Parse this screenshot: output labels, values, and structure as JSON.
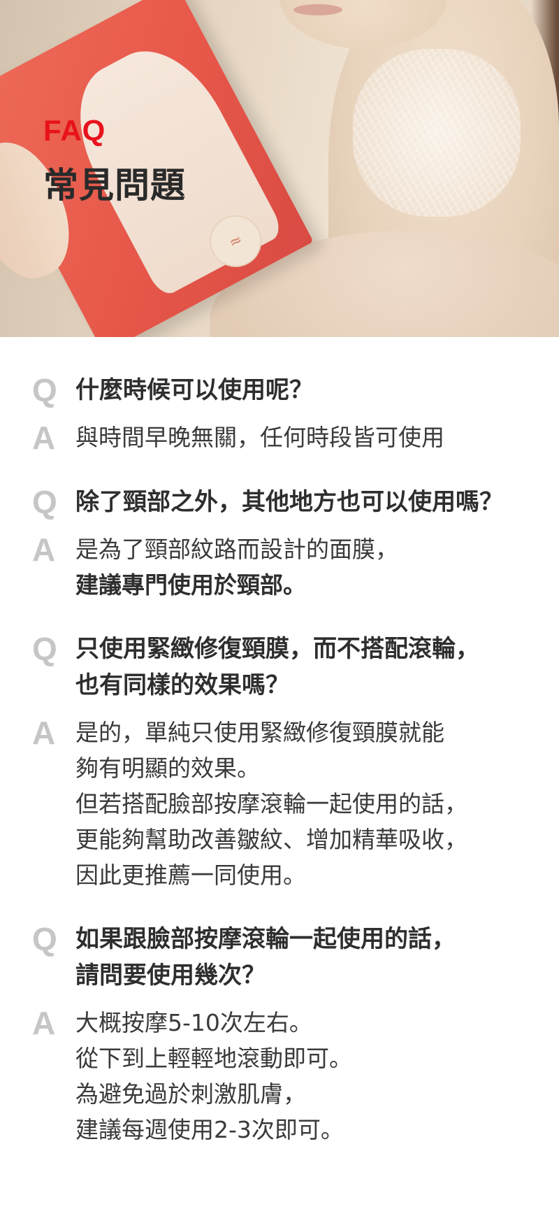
{
  "header": {
    "faq_label": "FAQ",
    "title": "常見問題"
  },
  "faq": [
    {
      "q_mark": "Q",
      "question_lines": [
        "什麼時候可以使用呢？"
      ],
      "a_mark": "A",
      "answer_lines": [
        {
          "text": "與時間早晚無關，任何時段皆可使用",
          "bold": false
        }
      ]
    },
    {
      "q_mark": "Q",
      "question_lines": [
        "除了頸部之外，其他地方也可以使用嗎？"
      ],
      "a_mark": "A",
      "answer_lines": [
        {
          "text": "是為了頸部紋路而設計的面膜，",
          "bold": false
        },
        {
          "text": "建議專門使用於頸部。",
          "bold": true
        }
      ]
    },
    {
      "q_mark": "Q",
      "question_lines": [
        "只使用緊緻修復頸膜，而不搭配滾輪，",
        "也有同樣的效果嗎？"
      ],
      "a_mark": "A",
      "answer_lines": [
        {
          "text": "是的，單純只使用緊緻修復頸膜就能",
          "bold": false
        },
        {
          "text": "夠有明顯的效果。",
          "bold": false
        },
        {
          "text": "但若搭配臉部按摩滾輪一起使用的話，",
          "bold": false
        },
        {
          "text": "更能夠幫助改善皺紋、增加精華吸收，",
          "bold": false
        },
        {
          "text": "因此更推薦一同使用。",
          "bold": false
        }
      ]
    },
    {
      "q_mark": "Q",
      "question_lines": [
        "如果跟臉部按摩滾輪一起使用的話，",
        "請問要使用幾次？"
      ],
      "a_mark": "A",
      "answer_lines": [
        {
          "text": "大概按摩5-10次左右。",
          "bold": false
        },
        {
          "text": "從下到上輕輕地滾動即可。",
          "bold": false
        },
        {
          "text": "為避免過於刺激肌膚，",
          "bold": false
        },
        {
          "text": "建議每週使用2-3次即可。",
          "bold": false
        }
      ]
    }
  ]
}
